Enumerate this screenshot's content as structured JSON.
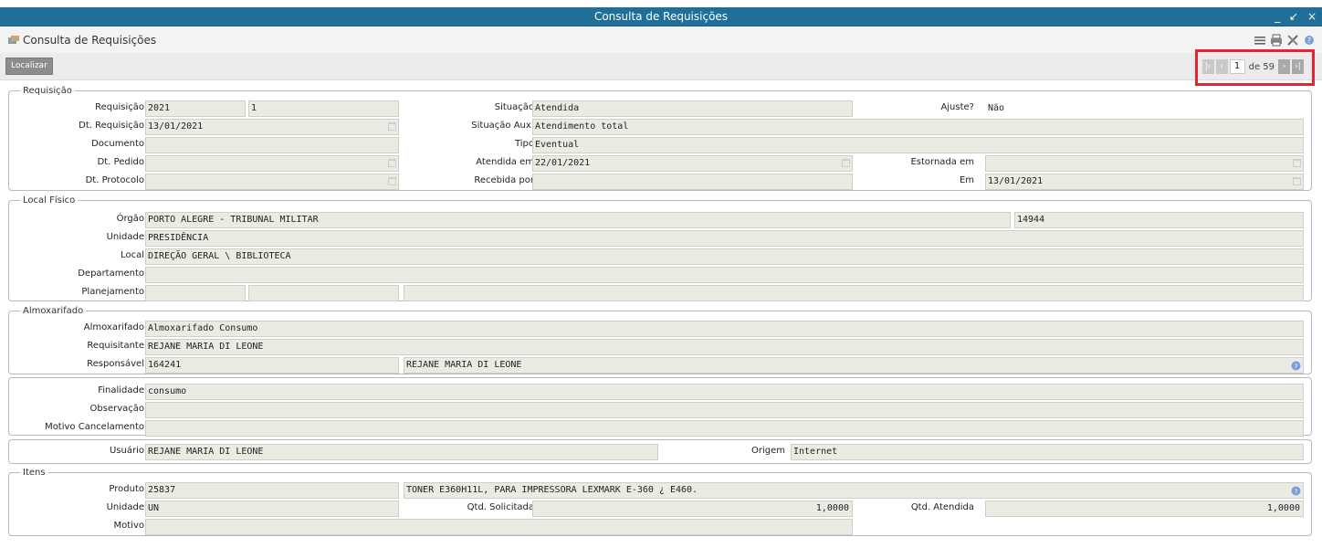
{
  "window": {
    "title": "Consulta de Requisições",
    "controls": {
      "minimize": "_",
      "restore": "↙",
      "close": "×"
    }
  },
  "app": {
    "title": "Consulta de Requisições",
    "icons": [
      "app-icon",
      "menu-icon",
      "print-icon",
      "tools-icon",
      "help-icon"
    ]
  },
  "toolbar": {
    "localizar": "Localizar"
  },
  "pager": {
    "current": "1",
    "of": "de 59"
  },
  "requisicao": {
    "legend": "Requisição",
    "requisicao_label": "Requisição",
    "requisicao_ano": "2021",
    "requisicao_num": "1",
    "situacao_label": "Situação",
    "situacao": "Atendida",
    "ajuste_label": "Ajuste?",
    "ajuste": "Não",
    "dt_requisicao_label": "Dt. Requisição",
    "dt_requisicao": "13/01/2021",
    "situacao_aux_label": "Situação Aux.",
    "situacao_aux": "Atendimento total",
    "documento_label": "Documento",
    "documento": "",
    "tipo_label": "Tipo",
    "tipo": "Eventual",
    "dt_pedido_label": "Dt. Pedido",
    "dt_pedido": "",
    "atendida_em_label": "Atendida em",
    "atendida_em": "22/01/2021",
    "estornada_em_label": "Estornada em",
    "estornada_em": "",
    "dt_protocolo_label": "Dt. Protocolo",
    "dt_protocolo": "",
    "recebida_por_label": "Recebida por",
    "recebida_por": "",
    "em_label": "Em",
    "em": "13/01/2021"
  },
  "local": {
    "legend": "Local Físico",
    "orgao_label": "Órgão",
    "orgao": "PORTO ALEGRE - TRIBUNAL MILITAR",
    "orgao_cod": "14944",
    "unidade_label": "Unidade",
    "unidade": "PRESIDÊNCIA",
    "local_label": "Local",
    "local": "DIREÇÃO GERAL \\ BIBLIOTECA",
    "departamento_label": "Departamento",
    "departamento": "",
    "planejamento_label": "Planejamento"
  },
  "almox": {
    "legend": "Almoxarifado",
    "almoxarifado_label": "Almoxarifado",
    "almoxarifado": "Almoxarifado Consumo",
    "requisitante_label": "Requisitante",
    "requisitante": "REJANE MARIA DI LEONE",
    "responsavel_label": "Responsável",
    "responsavel_cod": "164241",
    "responsavel_nome": "REJANE MARIA DI LEONE"
  },
  "finalidade": {
    "finalidade_label": "Finalidade",
    "finalidade": "consumo",
    "observacao_label": "Observação",
    "observacao": "",
    "motivo_label": "Motivo Cancelamento",
    "motivo": ""
  },
  "usuario": {
    "usuario_label": "Usuário",
    "usuario": "REJANE MARIA DI LEONE",
    "origem_label": "Origem",
    "origem": "Internet"
  },
  "itens": {
    "legend": "Itens",
    "produto_label": "Produto",
    "produto_cod": "25837",
    "produto_desc": "TONER E360H11L,  PARA IMPRESSORA LEXMARK E-360 ¿ E460.",
    "unidade_label": "Unidade",
    "unidade": "UN",
    "qtd_solicitada_label": "Qtd. Solicitada",
    "qtd_solicitada": "1,0000",
    "qtd_atendida_label": "Qtd. Atendida",
    "qtd_atendida": "1,0000",
    "motivo_label": "Motivo",
    "motivo": ""
  },
  "colors": {
    "titlebar": "#1f6f98",
    "highlight": "#e6232e",
    "field_bg": "#ebebe4"
  }
}
